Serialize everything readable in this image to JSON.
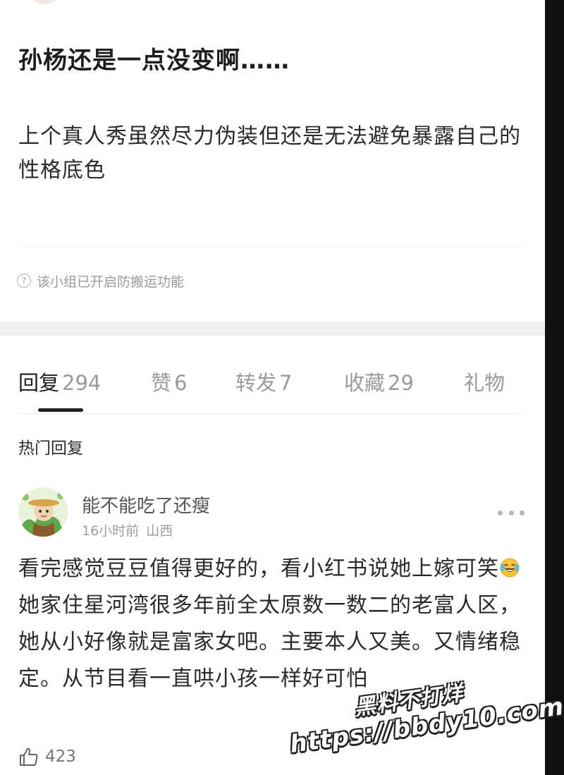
{
  "post": {
    "title": "孙杨还是一点没变啊……",
    "body": "上个真人秀虽然尽力伪装但还是无法避免暴露自己的性格底色",
    "notice": "该小组已开启防搬运功能",
    "notice_icon": "question-circle-icon"
  },
  "tabs": [
    {
      "label": "回复",
      "count": "294",
      "active": true
    },
    {
      "label": "赞",
      "count": "6"
    },
    {
      "label": "转发",
      "count": "7"
    },
    {
      "label": "收藏",
      "count": "29"
    },
    {
      "label": "礼物",
      "count": ""
    }
  ],
  "replies_section": {
    "heading": "热门回复"
  },
  "comment": {
    "username": "能不能吃了还瘦",
    "time": "16小时前",
    "location": "山西",
    "text_part1": "看完感觉豆豆值得更好的，看小红书说她上嫁可笑",
    "emoji": "laughing-tears-emoji",
    "text_part2": "她家住星河湾很多年前全太原数一数二的老富人区，她从小好像就是富家女吧。主要本人又美。又情绪稳定。从节目看一直哄小孩一样好可怕",
    "likes": "423",
    "like_icon": "thumbs-up-icon",
    "more_icon": "more-dots-icon"
  },
  "watermark": {
    "line1": "黑料不打烊",
    "line2": "https://bbdy10.com"
  },
  "colors": {
    "background": "#ffffff",
    "section_gap": "#efefef",
    "primary_text": "#1d1d1d",
    "secondary_text": "#9a9a9a",
    "right_edge": "#101010"
  }
}
